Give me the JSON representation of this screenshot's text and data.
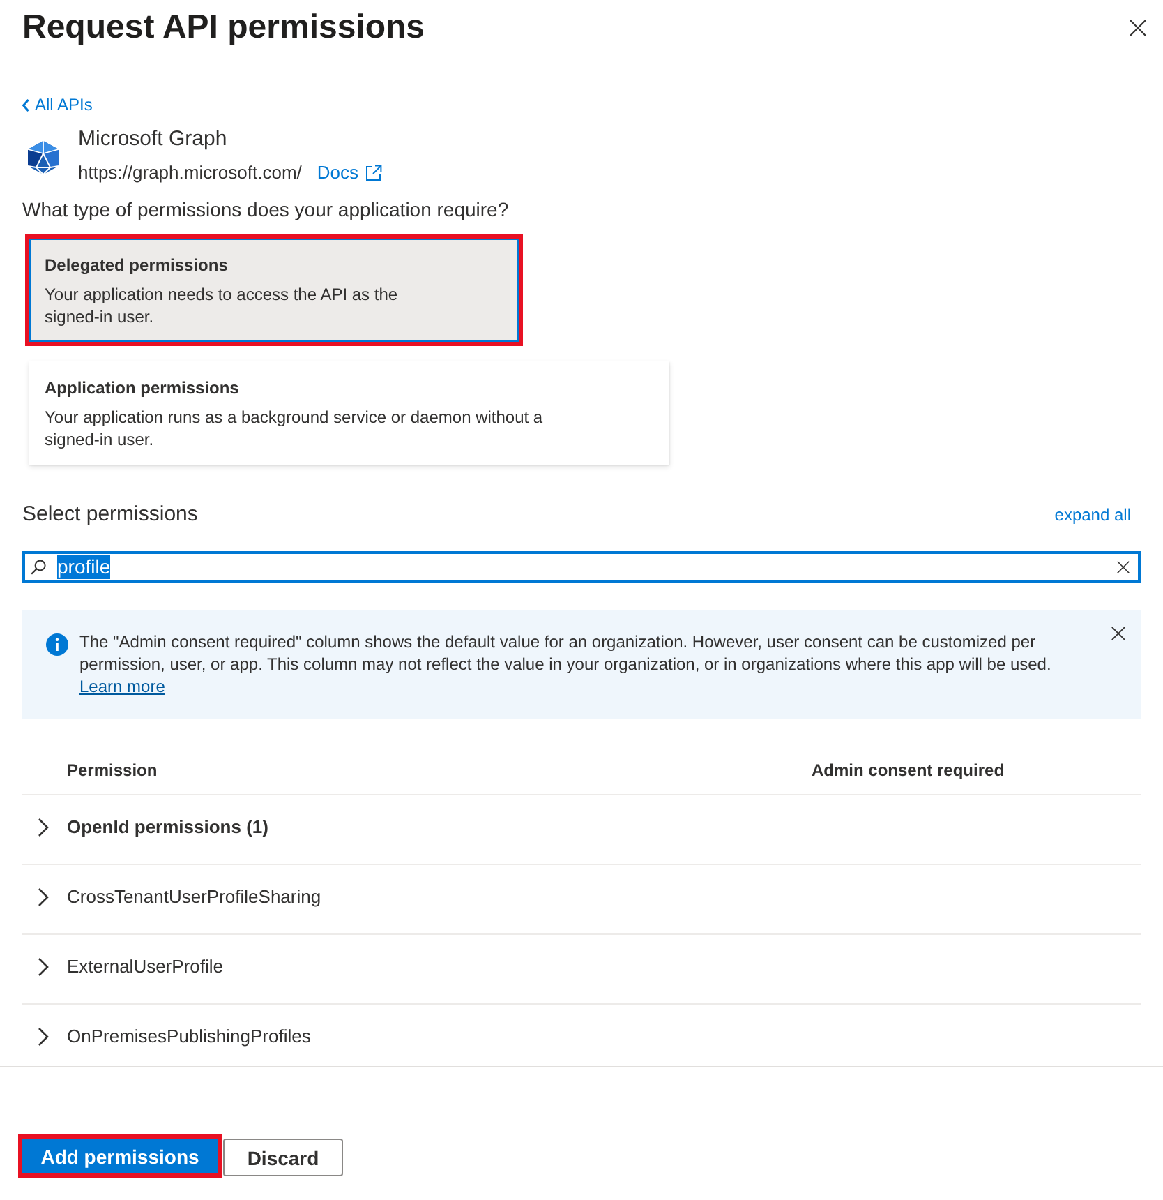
{
  "panel": {
    "title": "Request API permissions"
  },
  "back_link": "All APIs",
  "api": {
    "name": "Microsoft Graph",
    "url": "https://graph.microsoft.com/",
    "docs_link": "Docs"
  },
  "permission_type": {
    "question": "What type of permissions does your application require?",
    "options": [
      {
        "title": "Delegated permissions",
        "description": "Your application needs to access the API as the signed-in user.",
        "selected": true,
        "highlighted": true
      },
      {
        "title": "Application permissions",
        "description": "Your application runs as a background service or daemon without a signed-in user.",
        "selected": false,
        "highlighted": false
      }
    ]
  },
  "select_permissions": {
    "heading": "Select permissions",
    "expand_all": "expand all",
    "search": {
      "value": "profile",
      "text_selected": true
    }
  },
  "info_bar": {
    "text": "The \"Admin consent required\" column shows the default value for an organization. However, user consent can be customized per permission, user, or app. This column may not reflect the value in your organization, or in organizations where this app will be used.",
    "link": "Learn more"
  },
  "table": {
    "columns": [
      "Permission",
      "Admin consent required"
    ],
    "rows": [
      {
        "label": "OpenId permissions (1)",
        "kind": "group",
        "expanded": false
      },
      {
        "label": "CrossTenantUserProfileSharing",
        "kind": "permission",
        "expanded": false
      },
      {
        "label": "ExternalUserProfile",
        "kind": "permission",
        "expanded": false
      },
      {
        "label": "OnPremisesPublishingProfiles",
        "kind": "permission",
        "expanded": false
      }
    ]
  },
  "buttons": [
    {
      "label": "Add permissions",
      "kind": "primary",
      "highlighted": true
    },
    {
      "label": "Discard",
      "kind": "secondary",
      "highlighted": false
    }
  ]
}
